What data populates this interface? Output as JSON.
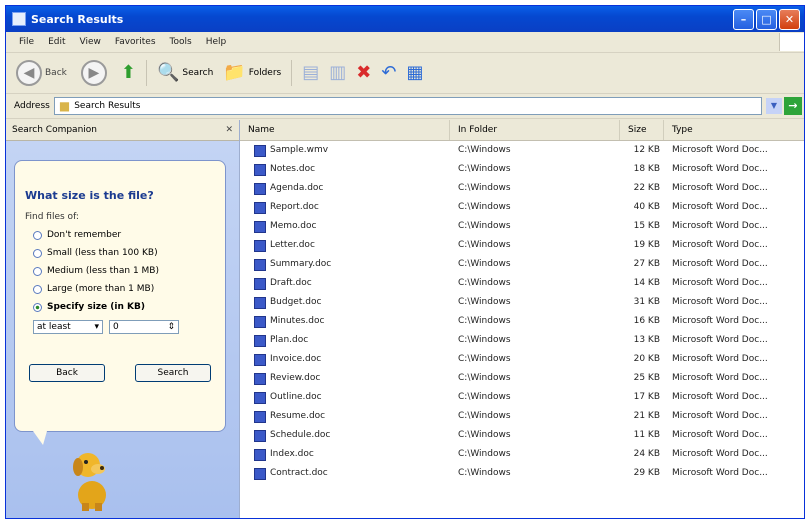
{
  "window": {
    "title": "Search Results"
  },
  "menus": [
    "File",
    "Edit",
    "View",
    "Favorites",
    "Tools",
    "Help"
  ],
  "toolbar": {
    "back": "Back",
    "search": "Search",
    "folders": "Folders"
  },
  "address": {
    "label": "Address",
    "value": "Search Results"
  },
  "left_panel": {
    "header": "Search Companion",
    "question": "What size is the file?",
    "subquestion": "Find files of:",
    "options": [
      "Don't remember",
      "Small (less than 100 KB)",
      "Medium (less than 1 MB)",
      "Large (more than 1 MB)",
      "Specify size (in KB)"
    ],
    "selected_index": 4,
    "spin_mode": "at least",
    "spin_value": "0",
    "back_button": "Back",
    "search_button": "Search"
  },
  "table": {
    "columns": [
      "Name",
      "In Folder",
      "Size",
      "Type"
    ],
    "rows": [
      {
        "name": "Sample.wmv",
        "folder": "C:\\Windows",
        "size": "12 KB",
        "type": "Microsoft Word Doc..."
      },
      {
        "name": "Notes.doc",
        "folder": "C:\\Windows",
        "size": "18 KB",
        "type": "Microsoft Word Doc..."
      },
      {
        "name": "Agenda.doc",
        "folder": "C:\\Windows",
        "size": "22 KB",
        "type": "Microsoft Word Doc..."
      },
      {
        "name": "Report.doc",
        "folder": "C:\\Windows",
        "size": "40 KB",
        "type": "Microsoft Word Doc..."
      },
      {
        "name": "Memo.doc",
        "folder": "C:\\Windows",
        "size": "15 KB",
        "type": "Microsoft Word Doc..."
      },
      {
        "name": "Letter.doc",
        "folder": "C:\\Windows",
        "size": "19 KB",
        "type": "Microsoft Word Doc..."
      },
      {
        "name": "Summary.doc",
        "folder": "C:\\Windows",
        "size": "27 KB",
        "type": "Microsoft Word Doc..."
      },
      {
        "name": "Draft.doc",
        "folder": "C:\\Windows",
        "size": "14 KB",
        "type": "Microsoft Word Doc..."
      },
      {
        "name": "Budget.doc",
        "folder": "C:\\Windows",
        "size": "31 KB",
        "type": "Microsoft Word Doc..."
      },
      {
        "name": "Minutes.doc",
        "folder": "C:\\Windows",
        "size": "16 KB",
        "type": "Microsoft Word Doc..."
      },
      {
        "name": "Plan.doc",
        "folder": "C:\\Windows",
        "size": "13 KB",
        "type": "Microsoft Word Doc..."
      },
      {
        "name": "Invoice.doc",
        "folder": "C:\\Windows",
        "size": "20 KB",
        "type": "Microsoft Word Doc..."
      },
      {
        "name": "Review.doc",
        "folder": "C:\\Windows",
        "size": "25 KB",
        "type": "Microsoft Word Doc..."
      },
      {
        "name": "Outline.doc",
        "folder": "C:\\Windows",
        "size": "17 KB",
        "type": "Microsoft Word Doc..."
      },
      {
        "name": "Resume.doc",
        "folder": "C:\\Windows",
        "size": "21 KB",
        "type": "Microsoft Word Doc..."
      },
      {
        "name": "Schedule.doc",
        "folder": "C:\\Windows",
        "size": "11 KB",
        "type": "Microsoft Word Doc..."
      },
      {
        "name": "Index.doc",
        "folder": "C:\\Windows",
        "size": "24 KB",
        "type": "Microsoft Word Doc..."
      },
      {
        "name": "Contract.doc",
        "folder": "C:\\Windows",
        "size": "29 KB",
        "type": "Microsoft Word Doc..."
      }
    ]
  },
  "colors": {
    "titlebar": "#0548d0",
    "panel": "#c5d5f4",
    "file_icon": "#3b59c8"
  },
  "icons": [
    "back-icon",
    "forward-icon",
    "up-icon",
    "search-icon",
    "folders-icon",
    "views-icon",
    "delete-icon",
    "undo-icon",
    "go-icon",
    "file-icon",
    "search-dog-icon"
  ]
}
